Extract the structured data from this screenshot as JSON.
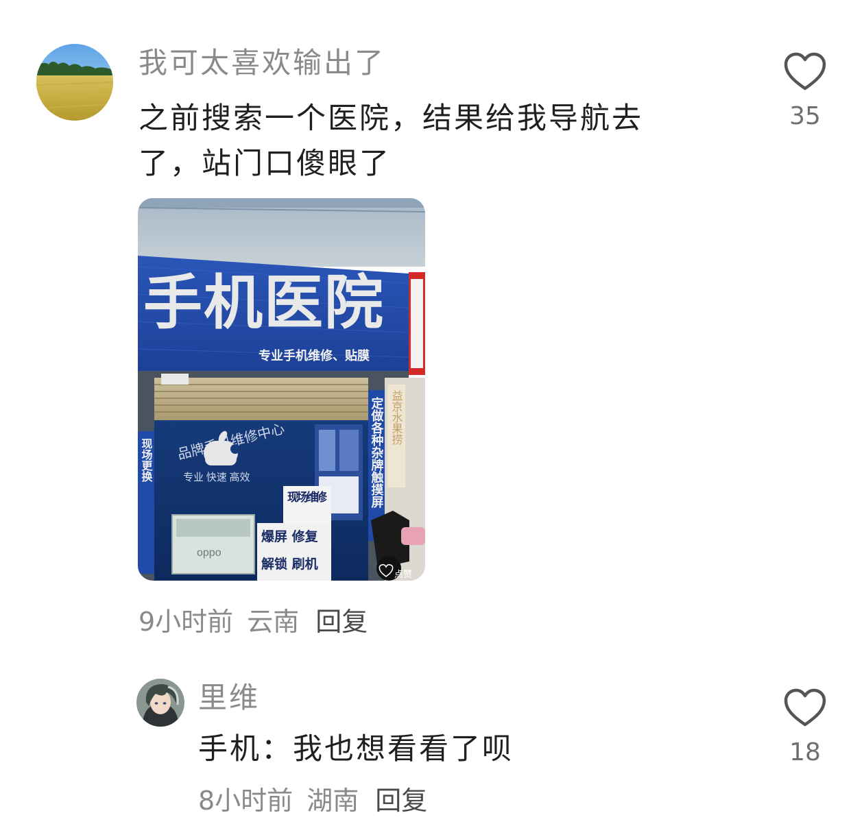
{
  "comments": [
    {
      "author": "我可太喜欢输出了",
      "content": "之前搜索一个医院，结果给我导航去了，站门口傻眼了",
      "time": "9小时前",
      "location": "云南",
      "reply_label": "回复",
      "like_count": "35",
      "avatar_icon": "wheat-field-avatar",
      "image": {
        "sign_main": "手机医院",
        "sign_sub": "专业手机维修、贴膜",
        "wall_arc": "品牌手机维修中心",
        "wall_slogan": "专业 快速 高效",
        "side_banner": "定做各种杂牌触摸屏",
        "board_1": "现场维修",
        "board_2": "爆屏 修复",
        "board_3": "解锁 刷机",
        "counter_brand": "oppo",
        "neighbor_sign": "益京水果捞",
        "left_banner": "现场更换",
        "watermark": "点赞"
      }
    },
    {
      "author": "里维",
      "content": "手机：我也想看看了呗",
      "time": "8小时前",
      "location": "湖南",
      "reply_label": "回复",
      "like_count": "18",
      "avatar_icon": "anime-character-avatar"
    }
  ],
  "icons": {
    "like": "heart-outline-icon"
  },
  "colors": {
    "author": "#8a8a8a",
    "content": "#1f1f1f",
    "meta": "#8a8a8a",
    "heart_stroke": "#555555",
    "sign_blue": "#1c3f95"
  }
}
